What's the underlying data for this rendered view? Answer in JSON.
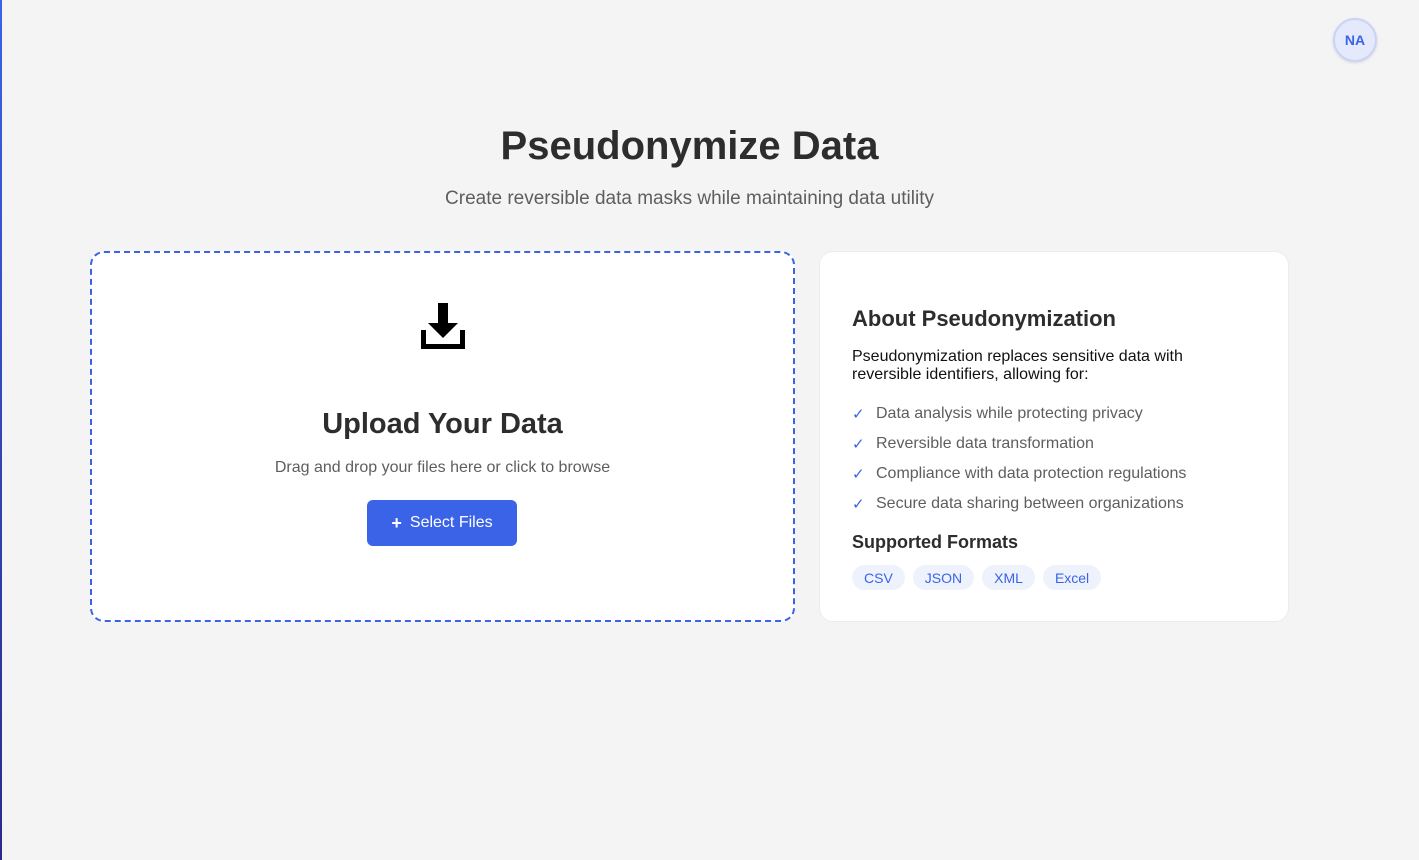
{
  "avatar": {
    "initials": "NA"
  },
  "header": {
    "title": "Pseudonymize Data",
    "subtitle": "Create reversible data masks while maintaining data utility"
  },
  "upload": {
    "icon": "download-icon",
    "title": "Upload Your Data",
    "description": "Drag and drop your files here or click to browse",
    "button_icon": "plus-icon",
    "button_label": "Select Files"
  },
  "info": {
    "title": "About Pseudonymization",
    "description": "Pseudonymization replaces sensitive data with reversible identifiers, allowing for:",
    "check_symbol": "✓",
    "benefits": [
      "Data analysis while protecting privacy",
      "Reversible data transformation",
      "Compliance with data protection regulations",
      "Secure data sharing between organizations"
    ],
    "formats_title": "Supported Formats",
    "formats": [
      "CSV",
      "JSON",
      "XML",
      "Excel"
    ]
  },
  "colors": {
    "accent": "#3a63e8",
    "background": "#f4f4f4",
    "card": "#ffffff"
  }
}
